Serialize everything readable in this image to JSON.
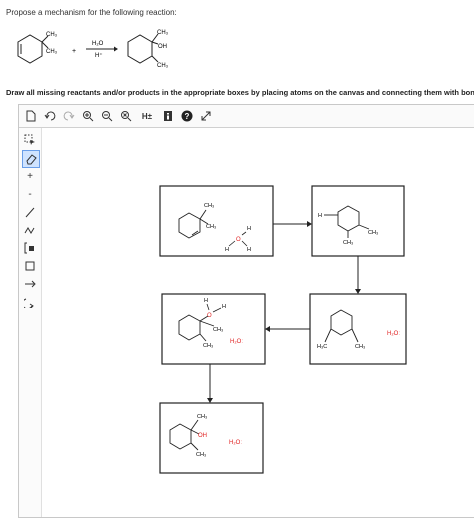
{
  "question": "Propose a mechanism for the following reaction:",
  "reaction": {
    "reactant_ch3_top": "CH₃",
    "reactant_ch3_bottom": "CH₃",
    "plus": "+",
    "reagent_top": "H₂O",
    "reagent_bottom": "H⁺",
    "product_ch3_top": "CH₃",
    "product_oh": "OH",
    "product_ch3_bottom": "CH₃"
  },
  "instruction": "Draw all missing reactants and/or products in the appropriate boxes by placing atoms on the canvas and connecting them with bonds. Add charges where needed.",
  "toolbar": {
    "hs_label": "H±",
    "help": "?"
  },
  "sidebar": {
    "plus": "+",
    "minus": "-"
  },
  "canvas_labels": {
    "b1_ch3_top": "CH₃",
    "b1_ch3_bottom": "CH₃",
    "b1_h_top": "H",
    "b1_o": "O",
    "b1_h_left": "H",
    "b1_h_right": "H",
    "b2_h": "H",
    "b2_ch3_right": "CH₃",
    "b2_ch3_bottom": "CH₃",
    "b3_h_water": "H₂Oː",
    "b3_ch3_left": "H₃C",
    "b3_ch3_right": "CH₃",
    "b4_h_top": "H",
    "b4_h_right": "H",
    "b4_o": "O",
    "b4_ch3_top": "CH₃",
    "b4_ch3_bottom": "CH₃",
    "b4_water": "H₂Oː",
    "b5_ch3_top": "CH₃",
    "b5_oh": "OH",
    "b5_ch3_bottom": "CH₃",
    "b5_water": "H₂Oː"
  },
  "colors": {
    "red": "#e02020",
    "line": "#222222",
    "accent": "#6a9ee8"
  }
}
